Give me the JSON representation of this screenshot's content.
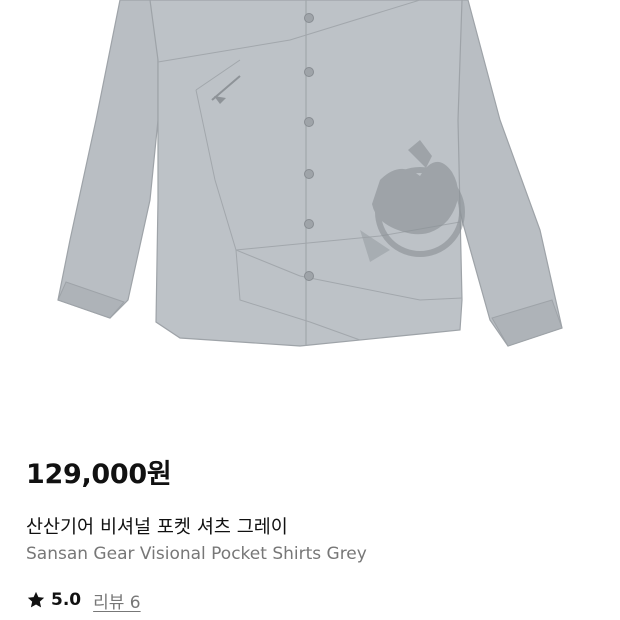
{
  "product": {
    "image_icon": "shirt-product-image",
    "price": "129,000원",
    "name_ko": "산산기어 비셔널 포켓 셔츠 그레이",
    "name_en": "Sansan Gear Visional Pocket Shirts Grey",
    "rating": "5.0",
    "review_link": "리뷰 6",
    "star_icon": "star-icon"
  },
  "colors": {
    "shirt": "#b9bec3",
    "shirt_shadow": "#a6abb0",
    "price": "#111111",
    "secondary_text": "#777777"
  }
}
